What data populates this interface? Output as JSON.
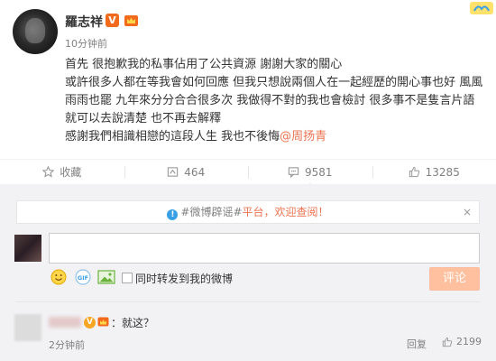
{
  "post": {
    "username": "羅志祥",
    "verified_badge": "V",
    "timestamp": "10分钟前",
    "lines": [
      "首先 很抱歉我的私事佔用了公共資源 謝謝大家的關心",
      "或許很多人都在等我會如何回應 但我只想說兩個人在一起經歷的開心事也好 風風",
      "雨雨也罷 九年來分分合合很多次 我做得不對的我也會檢討 很多事不是隻言片語",
      "就可以去說清楚 也不再去解釋",
      "感謝我們相識相戀的這段人生 我也不後悔"
    ],
    "mention": "@周扬青"
  },
  "actions": {
    "favorite": "收藏",
    "repost": "464",
    "comment": "9581",
    "like": "13285"
  },
  "notice": {
    "prefix": "#微博辟谣#",
    "link": "平台，欢迎查阅！",
    "close": "×"
  },
  "composer": {
    "placeholder": "",
    "forward_label": "同时转发到我的微博",
    "submit_label": "评论",
    "gif_label": "GIF"
  },
  "comment": {
    "vip_badge": "V",
    "text": "：就这？",
    "time": "2分钟前",
    "reply_label": "回复",
    "likes": "2199"
  },
  "colors": {
    "accent": "#eb7350",
    "panel": "#f2f2f5",
    "button": "#ffc09f",
    "link_blue": "#39a0e6"
  }
}
